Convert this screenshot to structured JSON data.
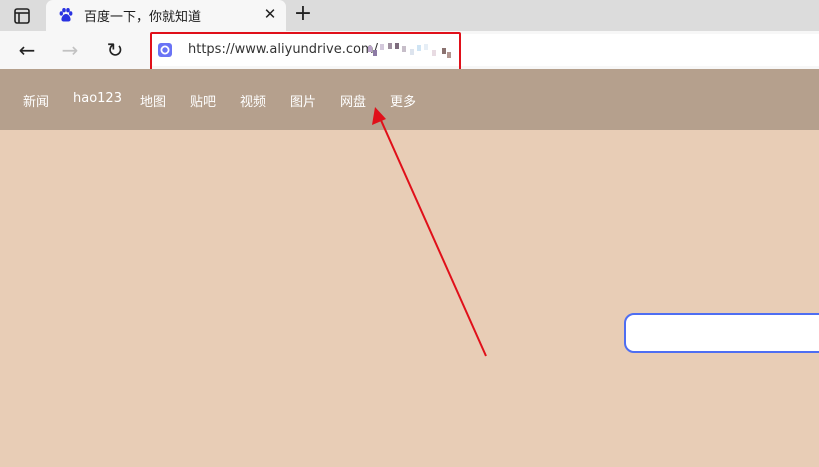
{
  "tab": {
    "title": "百度一下，你就知道",
    "close_symbol": "✕",
    "favicon": "baidu-paw-icon"
  },
  "toolbar": {
    "new_tab_symbol": "+",
    "back_symbol": "←",
    "forward_symbol": "→",
    "reload_symbol": "↻"
  },
  "address_bar": {
    "url": "https://www.aliyundrive.com/",
    "site_icon": "aliyundrive-icon"
  },
  "baidu_nav": {
    "links": [
      "新闻",
      "hao123",
      "地图",
      "贴吧",
      "视频",
      "图片",
      "网盘",
      "更多"
    ]
  },
  "annotation": {
    "color": "#e0101a"
  },
  "colors": {
    "nav_background": "#b5a08d",
    "page_background": "#e8cdb6",
    "search_border": "#4e6ef2"
  }
}
